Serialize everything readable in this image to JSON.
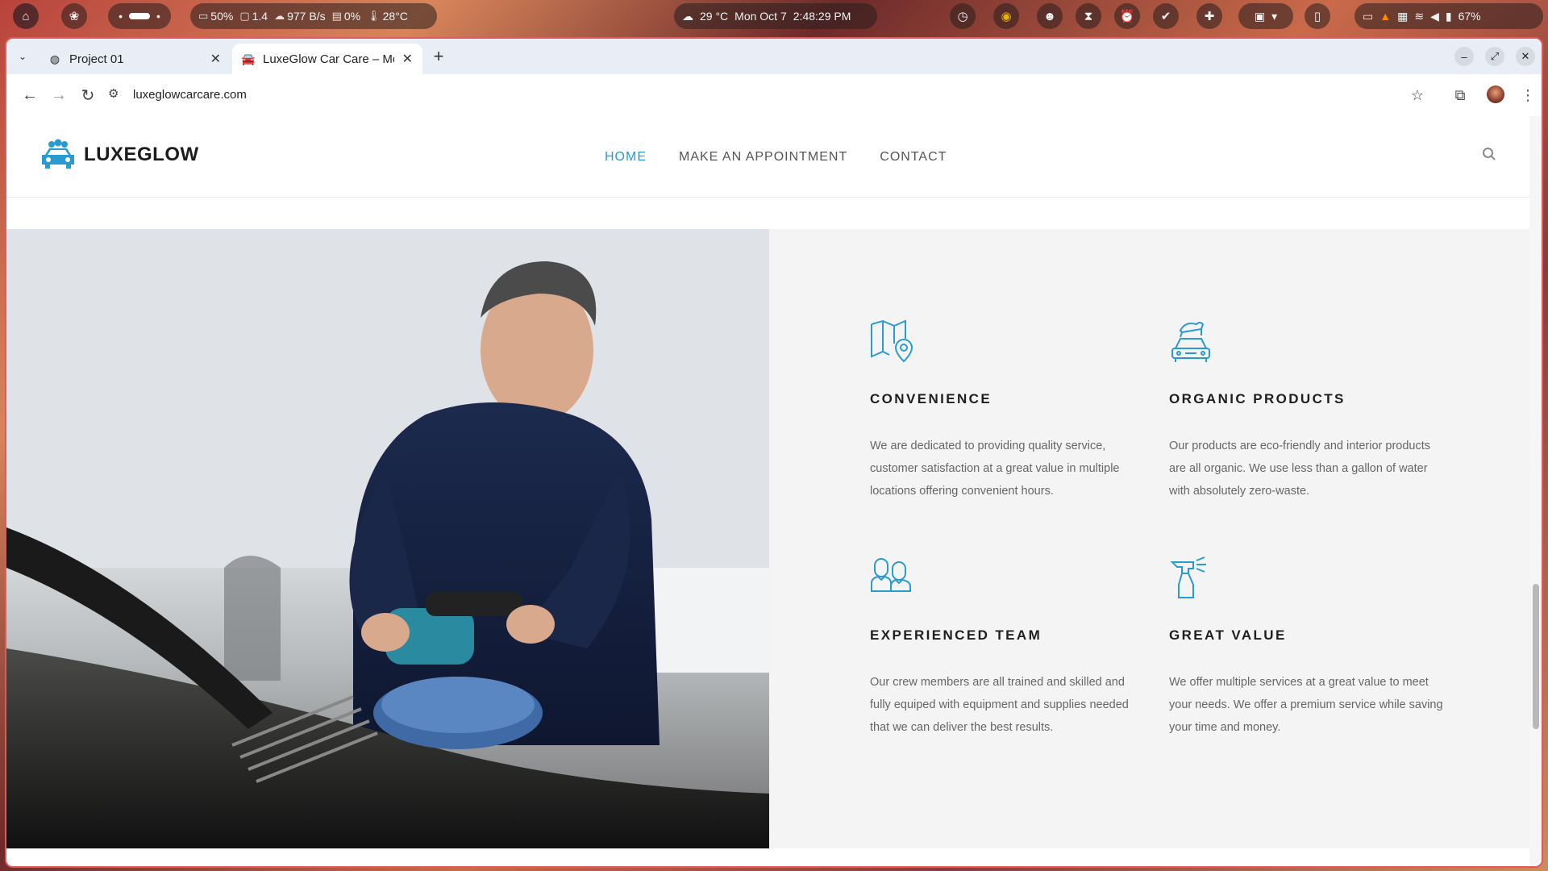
{
  "system_bar": {
    "battery": "50%",
    "monitor": "1.4",
    "network": "977 B/s",
    "cpu": "0%",
    "temp": "28°C",
    "weather": "29 °C",
    "date": "Mon Oct 7",
    "time": "2:48:29 PM",
    "battery_right": "67%"
  },
  "browser": {
    "tabs": [
      {
        "label": "Project 01",
        "active": false
      },
      {
        "label": "LuxeGlow Car Care – Mo",
        "active": true
      }
    ],
    "url": "luxeglowcarcare.com"
  },
  "site": {
    "brand": "LUXEGLOW",
    "nav": [
      "HOME",
      "MAKE AN APPOINTMENT",
      "CONTACT"
    ],
    "accent": "#2a9bd0"
  },
  "features": [
    {
      "icon": "map-pin-icon",
      "title": "CONVENIENCE",
      "text": "We are dedicated to providing quality service, customer satisfaction at a great value in multiple locations offering convenient hours."
    },
    {
      "icon": "car-wash-icon",
      "title": "ORGANIC PRODUCTS",
      "text": "Our products are eco-friendly and interior products are all organic. We use less than a gallon of water with absolutely zero-waste."
    },
    {
      "icon": "team-icon",
      "title": "EXPERIENCED TEAM",
      "text": "Our crew members are all trained and skilled and fully equiped with equipment and supplies needed that we can deliver the best results."
    },
    {
      "icon": "spray-bottle-icon",
      "title": "GREAT VALUE",
      "text": "We offer multiple services at a great value to meet your needs. We offer a premium service while saving your time and money."
    }
  ]
}
